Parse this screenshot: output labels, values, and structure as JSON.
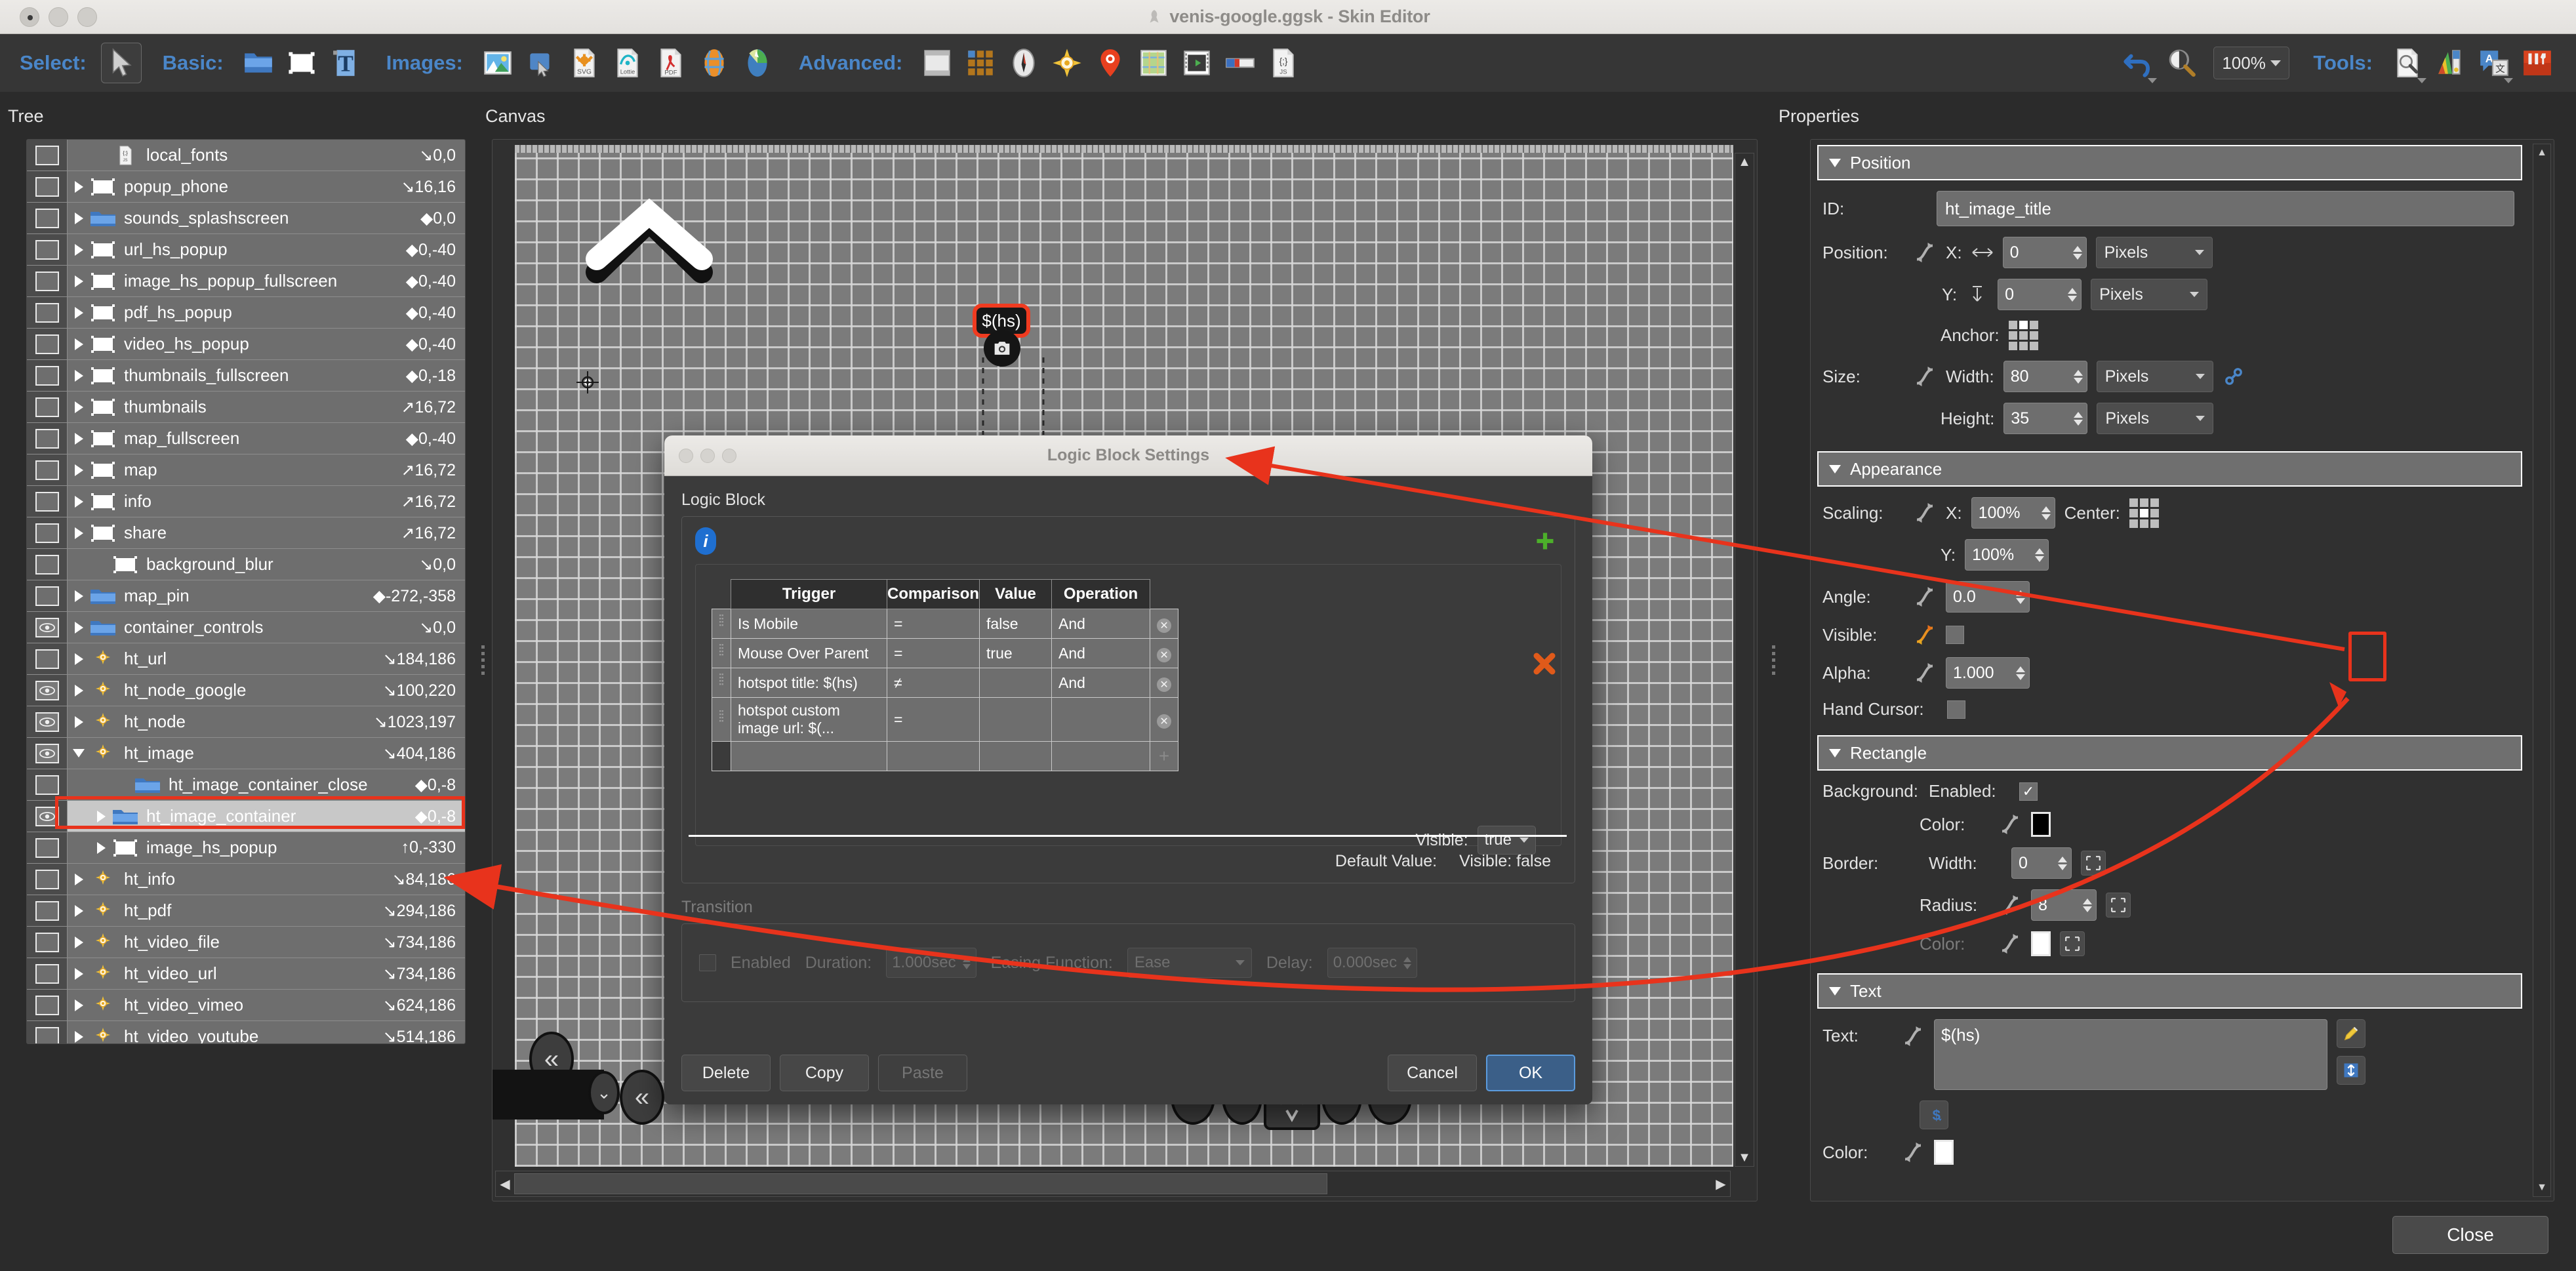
{
  "window": {
    "title": "venis-google.ggsk - Skin Editor",
    "close_button": "Close"
  },
  "toolbar": {
    "groups": [
      {
        "label": "Select:",
        "icons": [
          "arrow-cursor-icon"
        ]
      },
      {
        "label": "Basic:",
        "icons": [
          "folder-icon",
          "rectangle-icon",
          "text-icon"
        ]
      },
      {
        "label": "Images:",
        "icons": [
          "image-icon",
          "image-button-icon",
          "svg-icon",
          "lottie-icon",
          "pdf-icon",
          "map-globe-icon",
          "pie-chart-icon"
        ]
      },
      {
        "label": "Advanced:",
        "icons": [
          "window-icon",
          "grid-icon",
          "compass-icon",
          "hotspot-icon",
          "map-pin-icon",
          "map-thumb-icon",
          "video-icon",
          "progress-bar-icon",
          "js-file-icon"
        ]
      }
    ],
    "undo_label": "undo-icon",
    "zoom_tool": "zoom-magnifier-icon",
    "zoom_value": "100%",
    "tools_label": "Tools:",
    "tools_icons": [
      "inspect-file-icon",
      "color-palette-icon",
      "translate-icon",
      "toolbox-icon"
    ]
  },
  "panels": {
    "tree_caption": "Tree",
    "canvas_caption": "Canvas",
    "properties_caption": "Properties"
  },
  "tree": {
    "items": [
      {
        "name": "local_fonts",
        "coord": "0,0",
        "arrow": "down-right",
        "icon": "js-file-icon",
        "eye": false,
        "twisty": "none",
        "indent": 1,
        "selected": false
      },
      {
        "name": "popup_phone",
        "coord": "16,16",
        "arrow": "down-right",
        "icon": "white-rect-icon",
        "eye": false,
        "twisty": "closed",
        "indent": 0,
        "selected": false
      },
      {
        "name": "sounds_splashscreen",
        "coord": "0,0",
        "arrow": "diamond",
        "icon": "folder-icon",
        "eye": false,
        "twisty": "closed",
        "indent": 0,
        "selected": false
      },
      {
        "name": "url_hs_popup",
        "coord": "0,-40",
        "arrow": "diamond",
        "icon": "white-rect-icon",
        "eye": false,
        "twisty": "closed",
        "indent": 0,
        "selected": false
      },
      {
        "name": "image_hs_popup_fullscreen",
        "coord": "0,-40",
        "arrow": "diamond",
        "icon": "white-rect-icon",
        "eye": false,
        "twisty": "closed",
        "indent": 0,
        "selected": false
      },
      {
        "name": "pdf_hs_popup",
        "coord": "0,-40",
        "arrow": "diamond",
        "icon": "white-rect-icon",
        "eye": false,
        "twisty": "closed",
        "indent": 0,
        "selected": false
      },
      {
        "name": "video_hs_popup",
        "coord": "0,-40",
        "arrow": "diamond",
        "icon": "white-rect-icon",
        "eye": false,
        "twisty": "closed",
        "indent": 0,
        "selected": false
      },
      {
        "name": "thumbnails_fullscreen",
        "coord": "0,-18",
        "arrow": "diamond",
        "icon": "white-rect-icon",
        "eye": false,
        "twisty": "closed",
        "indent": 0,
        "selected": false
      },
      {
        "name": "thumbnails",
        "coord": "16,72",
        "arrow": "up-right",
        "icon": "white-rect-icon",
        "eye": false,
        "twisty": "closed",
        "indent": 0,
        "selected": false
      },
      {
        "name": "map_fullscreen",
        "coord": "0,-40",
        "arrow": "diamond",
        "icon": "white-rect-icon",
        "eye": false,
        "twisty": "closed",
        "indent": 0,
        "selected": false
      },
      {
        "name": "map",
        "coord": "16,72",
        "arrow": "up-right",
        "icon": "white-rect-icon",
        "eye": false,
        "twisty": "closed",
        "indent": 0,
        "selected": false
      },
      {
        "name": "info",
        "coord": "16,72",
        "arrow": "up-right",
        "icon": "white-rect-icon",
        "eye": false,
        "twisty": "closed",
        "indent": 0,
        "selected": false
      },
      {
        "name": "share",
        "coord": "16,72",
        "arrow": "up-right",
        "icon": "white-rect-icon",
        "eye": false,
        "twisty": "closed",
        "indent": 0,
        "selected": false
      },
      {
        "name": "background_blur",
        "coord": "0,0",
        "arrow": "down-right",
        "icon": "white-rect-icon",
        "eye": false,
        "twisty": "none",
        "indent": 1,
        "selected": false
      },
      {
        "name": "map_pin",
        "coord": "-272,-358",
        "arrow": "diamond",
        "icon": "folder-icon",
        "eye": false,
        "twisty": "closed",
        "indent": 0,
        "selected": false
      },
      {
        "name": "container_controls",
        "coord": "0,0",
        "arrow": "down-right",
        "icon": "folder-icon",
        "eye": true,
        "twisty": "closed",
        "indent": 0,
        "selected": false
      },
      {
        "name": "ht_url",
        "coord": "184,186",
        "arrow": "down-right",
        "icon": "hotspot-icon",
        "eye": false,
        "twisty": "closed",
        "indent": 0,
        "selected": false
      },
      {
        "name": "ht_node_google",
        "coord": "100,220",
        "arrow": "down-right",
        "icon": "hotspot-icon",
        "eye": true,
        "twisty": "closed",
        "indent": 0,
        "selected": false
      },
      {
        "name": "ht_node",
        "coord": "1023,197",
        "arrow": "down-right",
        "icon": "hotspot-icon",
        "eye": true,
        "twisty": "closed",
        "indent": 0,
        "selected": false
      },
      {
        "name": "ht_image",
        "coord": "404,186",
        "arrow": "down-right",
        "icon": "hotspot-icon",
        "eye": true,
        "twisty": "open",
        "indent": 0,
        "selected": false
      },
      {
        "name": "ht_image_container_close",
        "coord": "0,-8",
        "arrow": "diamond",
        "icon": "folder-icon",
        "eye": false,
        "twisty": "none",
        "indent": 2,
        "selected": false
      },
      {
        "name": "ht_image_container",
        "coord": "0,-8",
        "arrow": "diamond",
        "icon": "folder-icon",
        "eye": true,
        "twisty": "hollow",
        "indent": 1,
        "selected": true
      },
      {
        "name": "image_hs_popup",
        "coord": "0,-330",
        "arrow": "up",
        "icon": "white-rect-icon",
        "eye": false,
        "twisty": "closed",
        "indent": 1,
        "selected": false
      },
      {
        "name": "ht_info",
        "coord": "84,186",
        "arrow": "down-right",
        "icon": "hotspot-icon",
        "eye": false,
        "twisty": "closed",
        "indent": 0,
        "selected": false
      },
      {
        "name": "ht_pdf",
        "coord": "294,186",
        "arrow": "down-right",
        "icon": "hotspot-icon",
        "eye": false,
        "twisty": "closed",
        "indent": 0,
        "selected": false
      },
      {
        "name": "ht_video_file",
        "coord": "734,186",
        "arrow": "down-right",
        "icon": "hotspot-icon",
        "eye": false,
        "twisty": "closed",
        "indent": 0,
        "selected": false
      },
      {
        "name": "ht_video_url",
        "coord": "734,186",
        "arrow": "down-right",
        "icon": "hotspot-icon",
        "eye": false,
        "twisty": "closed",
        "indent": 0,
        "selected": false
      },
      {
        "name": "ht_video_vimeo",
        "coord": "624,186",
        "arrow": "down-right",
        "icon": "hotspot-icon",
        "eye": false,
        "twisty": "closed",
        "indent": 0,
        "selected": false
      },
      {
        "name": "ht_video_youtube",
        "coord": "514,186",
        "arrow": "down-right",
        "icon": "hotspot-icon",
        "eye": false,
        "twisty": "closed",
        "indent": 0,
        "selected": false
      }
    ]
  },
  "canvas": {
    "hotspot_badge_text": "$(hs)",
    "highlight_color": "#f03b20"
  },
  "dialog": {
    "title": "Logic Block Settings",
    "section_label": "Logic Block",
    "table": {
      "headers": [
        "Trigger",
        "Comparison",
        "Value",
        "Operation"
      ],
      "rows": [
        {
          "trigger": "Is Mobile",
          "comparison": "=",
          "value": "false",
          "operation": "And"
        },
        {
          "trigger": "Mouse Over Parent",
          "comparison": "=",
          "value": "true",
          "operation": "And"
        },
        {
          "trigger": "hotspot title: $(hs)",
          "comparison": "≠",
          "value": "",
          "operation": "And"
        },
        {
          "trigger": "hotspot custom image url: $(...",
          "comparison": "=",
          "value": "",
          "operation": ""
        },
        {
          "trigger": "",
          "comparison": "",
          "value": "",
          "operation": ""
        }
      ],
      "add_row_label": "+",
      "delete_row_label": "✕"
    },
    "visible_label": "Visible:",
    "visible_value": "true",
    "default_value_label": "Default Value:",
    "default_value_text": "Visible:  false",
    "transition": {
      "label": "Transition",
      "enabled_label": "Enabled",
      "enabled_checked": false,
      "duration_label": "Duration:",
      "duration_value": "1.000sec",
      "easing_label": "Easing Function:",
      "easing_value": "Ease",
      "delay_label": "Delay:",
      "delay_value": "0.000sec"
    },
    "buttons": {
      "delete": "Delete",
      "copy": "Copy",
      "paste": "Paste",
      "cancel": "Cancel",
      "ok": "OK"
    }
  },
  "properties": {
    "position": {
      "header": "Position",
      "id_label": "ID:",
      "id_value": "ht_image_title",
      "position_label": "Position:",
      "x_label": "X:",
      "x_value": "0",
      "x_unit": "Pixels",
      "y_label": "Y:",
      "y_value": "0",
      "y_unit": "Pixels",
      "anchor_label": "Anchor:",
      "size_label": "Size:",
      "width_label": "Width:",
      "width_value": "80",
      "width_unit": "Pixels",
      "height_label": "Height:",
      "height_value": "35",
      "height_unit": "Pixels"
    },
    "appearance": {
      "header": "Appearance",
      "scaling_label": "Scaling:",
      "scale_x_label": "X:",
      "scale_x_value": "100%",
      "center_label": "Center:",
      "scale_y_label": "Y:",
      "scale_y_value": "100%",
      "angle_label": "Angle:",
      "angle_value": "0.0",
      "visible_label": "Visible:",
      "visible_checked": false,
      "alpha_label": "Alpha:",
      "alpha_value": "1.000",
      "hand_cursor_label": "Hand Cursor:",
      "hand_cursor_checked": false
    },
    "rectangle": {
      "header": "Rectangle",
      "background_label": "Background:",
      "enabled_label": "Enabled:",
      "enabled_checked": true,
      "color_label": "Color:",
      "background_color": "#000000",
      "border_label": "Border:",
      "border_width_label": "Width:",
      "border_width_value": "0",
      "radius_label": "Radius:",
      "radius_value": "8",
      "border_color_label": "Color:",
      "border_color": "#ffffff"
    },
    "text": {
      "header": "Text",
      "text_label": "Text:",
      "text_value": "$(hs)",
      "color_label": "Color:",
      "text_color": "#ffffff",
      "edit_icon": "pencil-icon",
      "autosize_icon": "autosize-icon",
      "variable_icon": "dollar-variable-icon"
    }
  }
}
